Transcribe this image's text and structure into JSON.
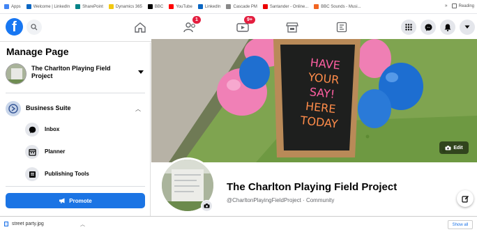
{
  "bookmarks": {
    "items": [
      {
        "label": "Apps",
        "color": "#4285f4"
      },
      {
        "label": "Welcome | LinkedIn",
        "color": "#0a66c2"
      },
      {
        "label": "SharePoint",
        "color": "#038387"
      },
      {
        "label": "Dynamics 365",
        "color": "#f2c811"
      },
      {
        "label": "BBC",
        "color": "#000000"
      },
      {
        "label": "YouTube",
        "color": "#ff0000"
      },
      {
        "label": "LinkedIn",
        "color": "#0a66c2"
      },
      {
        "label": "Cascade PM",
        "color": "#888888"
      },
      {
        "label": "Santander - Online...",
        "color": "#ec0000"
      },
      {
        "label": "BBC Sounds - Musi...",
        "color": "#f26522"
      }
    ],
    "reading_list": "Reading"
  },
  "nav": {
    "logo_letter": "f",
    "friends_badge": "1",
    "watch_badge": "9+"
  },
  "sidebar": {
    "title": "Manage Page",
    "page_name": "The Charlton Playing Field Project",
    "business_suite": "Business Suite",
    "items": [
      {
        "label": "Inbox",
        "icon": "chat-bubble-icon"
      },
      {
        "label": "Planner",
        "icon": "calendar-icon"
      },
      {
        "label": "Publishing Tools",
        "icon": "publishing-tools-icon"
      }
    ],
    "promote_label": "Promote"
  },
  "cover": {
    "sign_lines": [
      "HAVE",
      "YOUR",
      "SAY!",
      "HERE",
      "TODAY"
    ],
    "edit_label": "Edit"
  },
  "profile": {
    "title": "The Charlton Playing Field Project",
    "subtitle": "@CharltonPlayingFieldProject · Community"
  },
  "downloads": {
    "file_name": "street party.jpg",
    "show_all": "Show all"
  },
  "colors": {
    "brand": "#1877f2",
    "promote": "#1b74e4",
    "badge": "#e41e3f"
  }
}
